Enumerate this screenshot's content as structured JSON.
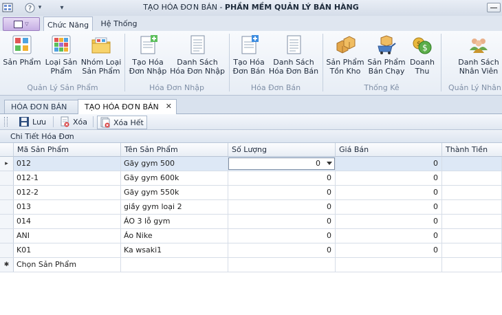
{
  "window": {
    "title_prefix": "TẠO HÓA ĐƠN BÁN - ",
    "title_app": "PHẦN MỀM QUẢN LÝ BÁN HÀNG"
  },
  "ribbon_tabs": [
    "Chức Năng",
    "Hệ Thống"
  ],
  "ribbon_groups": [
    {
      "label": "Quản Lý Sản Phẩm",
      "buttons": [
        "Sản Phẩm",
        "Loại Sản\nPhẩm",
        "Nhóm Loại\nSản Phẩm"
      ]
    },
    {
      "label": "Hóa Đơn Nhập",
      "buttons": [
        "Tạo Hóa\nĐơn Nhập",
        "Danh Sách\nHóa Đơn Nhập"
      ]
    },
    {
      "label": "Hóa Đơn Bán",
      "buttons": [
        "Tạo Hóa\nĐơn Bán",
        "Danh Sách\nHóa Đơn Bán"
      ]
    },
    {
      "label": "Thống Kê",
      "buttons": [
        "Sản Phẩm\nTồn Kho",
        "Sản Phẩm\nBán Chạy",
        "Doanh\nThu"
      ]
    },
    {
      "label": "Quản Lý Nhân Viên",
      "buttons": [
        "Danh Sách\nNhân Viên"
      ]
    }
  ],
  "doc_tabs": [
    "HÓA ĐƠN BÁN",
    "TẠO HÓA ĐƠN BÁN"
  ],
  "toolbar": {
    "save": "Lưu",
    "delete": "Xóa",
    "delete_all": "Xóa Hết"
  },
  "grid": {
    "caption": "Chi Tiết Hóa Đơn",
    "columns": [
      "Mã Sản Phẩm",
      "Tên Sản Phẩm",
      "Số Lượng",
      "Giá Bán",
      "Thành Tiền"
    ],
    "rows": [
      {
        "code": "012",
        "name": "Gãy gym 500",
        "qty": "0",
        "price": "0",
        "total": ""
      },
      {
        "code": "012-1",
        "name": "Gãy gym 600k",
        "qty": "0",
        "price": "0",
        "total": ""
      },
      {
        "code": "012-2",
        "name": "Gãy gym 550k",
        "qty": "0",
        "price": "0",
        "total": ""
      },
      {
        "code": "013",
        "name": "giầy gym loại 2",
        "qty": "0",
        "price": "0",
        "total": ""
      },
      {
        "code": "014",
        "name": "ÁO 3 lỗ gym",
        "qty": "0",
        "price": "0",
        "total": ""
      },
      {
        "code": "ANI",
        "name": "Áo Nike",
        "qty": "0",
        "price": "0",
        "total": ""
      },
      {
        "code": "K01",
        "name": "Ka wsaki1",
        "qty": "0",
        "price": "0",
        "total": ""
      }
    ],
    "new_row_placeholder": "Chọn Sản Phẩm",
    "new_row_marker": "✱",
    "current_row_marker": "▸"
  },
  "icons": {
    "help": "?",
    "dropdown": "▾",
    "close_tab": "✕"
  }
}
